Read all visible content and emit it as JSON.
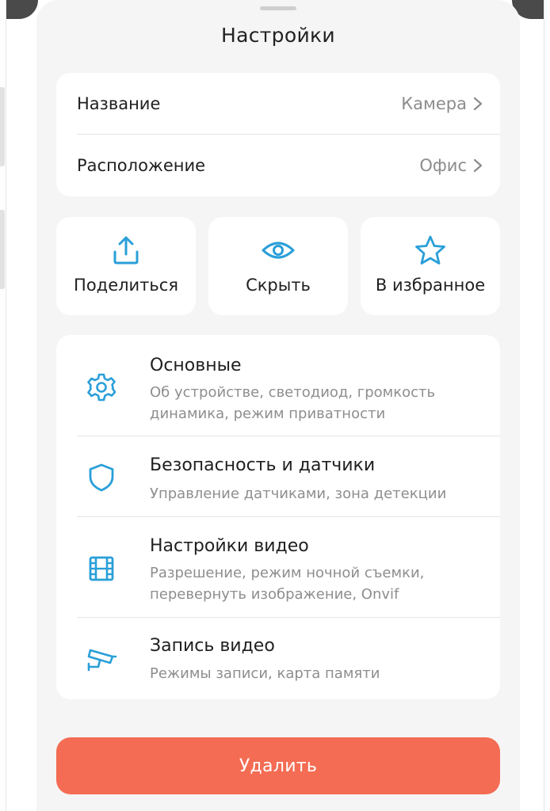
{
  "header": {
    "title": "Настройки"
  },
  "info_rows": [
    {
      "label": "Название",
      "value": "Камера"
    },
    {
      "label": "Расположение",
      "value": "Офис"
    }
  ],
  "actions": [
    {
      "label": "Поделиться",
      "icon": "share-icon"
    },
    {
      "label": "Скрыть",
      "icon": "eye-icon"
    },
    {
      "label": "В избранное",
      "icon": "star-icon"
    }
  ],
  "menu": [
    {
      "title": "Основные",
      "subtitle_lines": [
        "Об устройстве, светодиод, громкость",
        "динамика, режим приватности"
      ],
      "icon": "gear-icon"
    },
    {
      "title": "Безопасность и датчики",
      "subtitle_lines": [
        "Управление датчиками, зона детекции"
      ],
      "icon": "shield-icon"
    },
    {
      "title": "Настройки видео",
      "subtitle_lines": [
        "Разрешение, режим ночной съемки,",
        "перевернуть изображение, Onvif"
      ],
      "icon": "film-icon"
    },
    {
      "title": "Запись видео",
      "subtitle_lines": [
        "Режимы записи, карта памяти"
      ],
      "icon": "security-camera-icon"
    }
  ],
  "delete_button": {
    "label": "Удалить"
  },
  "colors": {
    "accent": "#2a9fd8",
    "danger": "#f46c53",
    "sheet_background": "#f5f5f5",
    "card": "#ffffff",
    "secondary_text": "#8e8e8e"
  }
}
